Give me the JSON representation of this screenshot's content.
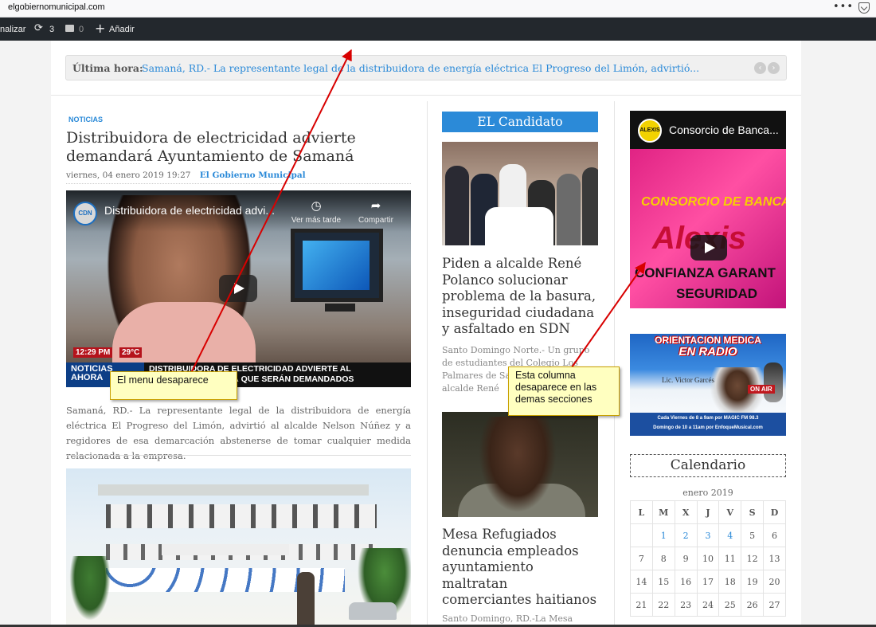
{
  "browser": {
    "url": "elgobiernomunicipal.com",
    "page_actions": "•••"
  },
  "admin_bar": {
    "customize": "nalizar",
    "updates_count": "3",
    "comments_count": "0",
    "add_label": "Añadir"
  },
  "ticker": {
    "label": "Última hora:",
    "text": "Samaná, RD.- La representante legal de la distribuidora de energía eléctrica El Progreso del Limón, advirtió..."
  },
  "main_article": {
    "category": "NOTICIAS",
    "title": "Distribuidora de electricidad advierte demandará Ayuntamiento de Samaná",
    "date": "viernes, 04 enero 2019 19:27",
    "author": "El Gobierno Municipal",
    "video": {
      "channel": "CDN",
      "title": "Distribuidora de electricidad advi...",
      "watch_later": "Ver más tarde",
      "share": "Compartir",
      "clock": "12:29 PM",
      "temp": "29°C",
      "band_tag": "NOTICIAS AHORA",
      "band_line1": "DISTRIBUIDORA DE ELECTRICIDAD ADVIERTE AL",
      "band_line2": "ANÁ QUE SERÁN DEMANDADOS"
    },
    "excerpt": "Samaná, RD.- La representante legal de la distribuidora de energía eléctrica El Progreso del Limón, advirtió al alcalde Nelson Núñez y a regidores de esa demarcación abstenerse de tomar cualquier medida relacionada  a la empresa."
  },
  "candidate": {
    "header": "EL Candidato",
    "article1": {
      "title": "Piden a alcalde René Polanco solucionar problema de la basura, inseguridad ciudadana y asfaltado en SDN",
      "excerpt": "Santo Domingo Norte.- Un grupo de estudiantes del Colegio Los Palmares de Sabana Pedio al alcalde René"
    },
    "article2": {
      "title": "Mesa Refugiados denuncia empleados ayuntamiento maltratan comerciantes haitianos",
      "excerpt": "Santo Domingo, RD.-La Mesa"
    }
  },
  "sidebar": {
    "ad1": {
      "title": "Consorcio de Banca...",
      "line1": "CONSORCIO DE BANCA",
      "line2": "Alexis",
      "line3": "CONFIANZA GARANT",
      "line4": "SEGURIDAD"
    },
    "ad2": {
      "title1": "ORIENTACION MEDICA",
      "title2": "EN RADIO",
      "doctor": "Lic. Victor Garcés",
      "onair": "ON AIR",
      "band1": "Cada Viernes de 8 a 9am por MAGIC FM 98.3",
      "band2": "Domingo de 10 a 11am por EnfoqueMusical.com"
    },
    "calendar": {
      "title": "Calendario",
      "month": "enero 2019",
      "weekdays": [
        "L",
        "M",
        "X",
        "J",
        "V",
        "S",
        "D"
      ],
      "weeks": [
        [
          "",
          "1",
          "2",
          "3",
          "4",
          "5",
          "6"
        ],
        [
          "7",
          "8",
          "9",
          "10",
          "11",
          "12",
          "13"
        ],
        [
          "14",
          "15",
          "16",
          "17",
          "18",
          "19",
          "20"
        ],
        [
          "21",
          "22",
          "23",
          "24",
          "25",
          "26",
          "27"
        ]
      ],
      "linked_days": [
        "1",
        "2",
        "3",
        "4"
      ]
    }
  },
  "annotations": {
    "note1": "El menu desaparece",
    "note2": "Esta columna desaparece en las demas secciones",
    "color": "#d80000"
  },
  "colors": {
    "accent": "#2b8ad8",
    "admin_bar": "#23282d",
    "note_bg": "#ffffc0"
  }
}
